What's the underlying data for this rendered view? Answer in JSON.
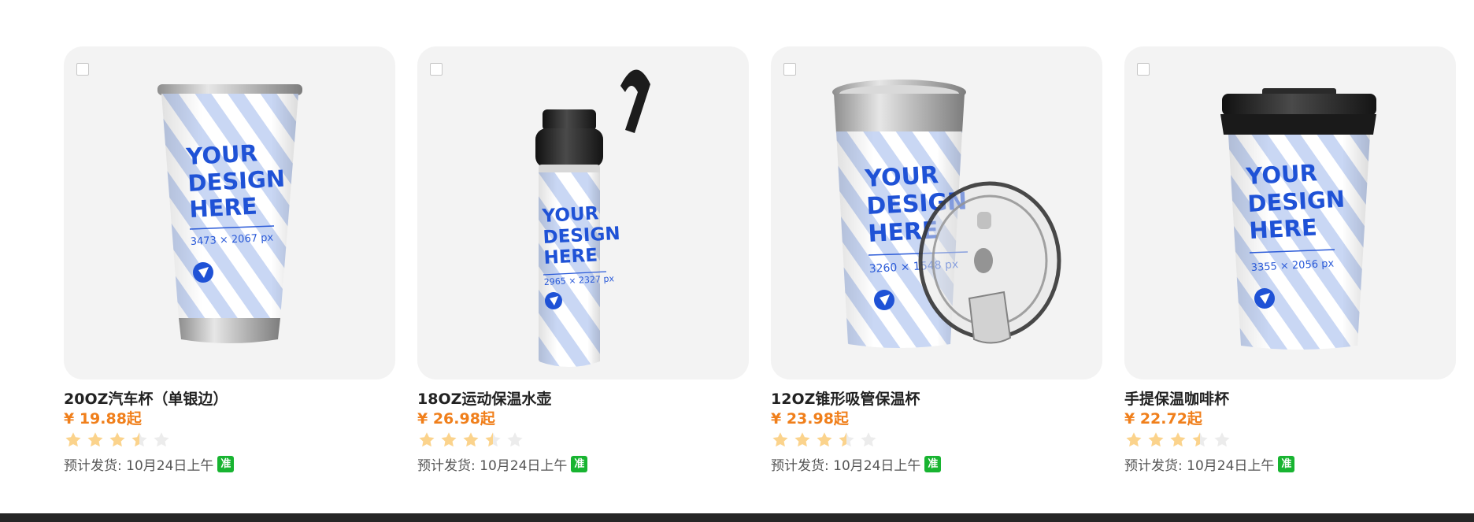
{
  "products": [
    {
      "title": "20OZ汽车杯（单银边）",
      "price": "¥ 19.88起",
      "rating": 3.5,
      "ship": "预计发货: 10月24日上午",
      "badge": "准",
      "design_line1": "YOUR",
      "design_line2": "DESIGN",
      "design_line3": "HERE",
      "dims": "3473 × 2067 px"
    },
    {
      "title": "18OZ运动保温水壶",
      "price": "¥ 26.98起",
      "rating": 3.5,
      "ship": "预计发货: 10月24日上午",
      "badge": "准",
      "design_line1": "YOUR",
      "design_line2": "DESIGN",
      "design_line3": "HERE",
      "dims": "2965 × 2327 px"
    },
    {
      "title": "12OZ锥形吸管保温杯",
      "price": "¥ 23.98起",
      "rating": 3.5,
      "ship": "预计发货: 10月24日上午",
      "badge": "准",
      "design_line1": "YOUR",
      "design_line2": "DESIGN",
      "design_line3": "HERE",
      "dims": "3260 × 1548 px"
    },
    {
      "title": "手提保温咖啡杯",
      "price": "¥ 22.72起",
      "rating": 3.5,
      "ship": "预计发货: 10月24日上午",
      "badge": "准",
      "design_line1": "YOUR",
      "design_line2": "DESIGN",
      "design_line3": "HERE",
      "dims": "3355 × 2056 px"
    }
  ],
  "colors": {
    "price": "#f07f1b",
    "star_filled": "#fbd38c",
    "star_empty": "#ececec",
    "badge": "#18b431",
    "design_print": "#1f52d6"
  },
  "icons": {
    "star": "star-icon",
    "half_star": "half-star-icon",
    "logo": "bird-logo-icon"
  }
}
